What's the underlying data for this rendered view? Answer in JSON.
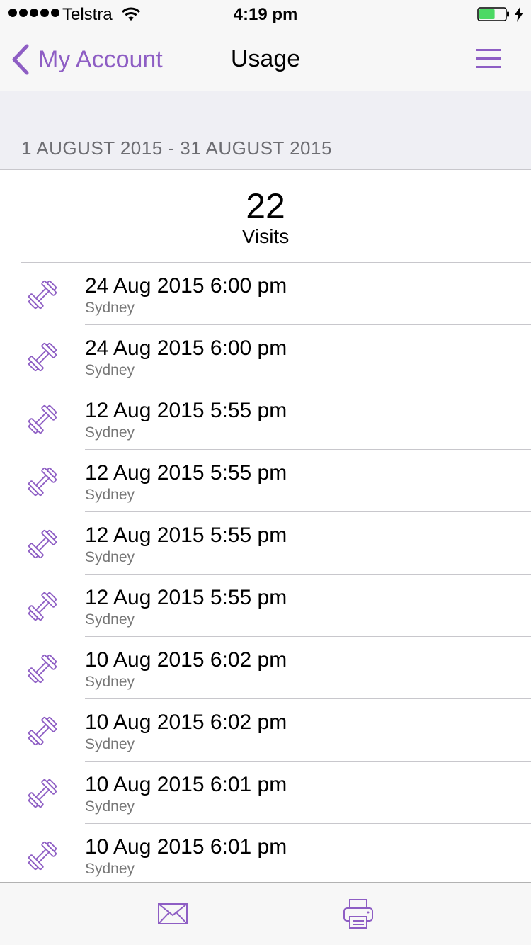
{
  "status_bar": {
    "carrier": "Telstra",
    "time": "4:19 pm",
    "signal_icon": "signal-dots-icon",
    "wifi_icon": "wifi-icon",
    "battery_icon": "battery-icon",
    "battery_level": 0.6,
    "charging_icon": "charging-bolt-icon"
  },
  "nav": {
    "back_label": "My Account",
    "title": "Usage",
    "back_icon": "chevron-left-icon",
    "menu_icon": "hamburger-menu-icon"
  },
  "period": {
    "label": "1 AUGUST 2015 - 31 AUGUST 2015"
  },
  "summary": {
    "count": "22",
    "label": "Visits"
  },
  "visits": [
    {
      "datetime": "24 Aug 2015 6:00 pm",
      "location": "Sydney"
    },
    {
      "datetime": "24 Aug 2015 6:00 pm",
      "location": "Sydney"
    },
    {
      "datetime": "12 Aug 2015 5:55 pm",
      "location": "Sydney"
    },
    {
      "datetime": "12 Aug 2015 5:55 pm",
      "location": "Sydney"
    },
    {
      "datetime": "12 Aug 2015 5:55 pm",
      "location": "Sydney"
    },
    {
      "datetime": "12 Aug 2015 5:55 pm",
      "location": "Sydney"
    },
    {
      "datetime": "10 Aug 2015 6:02 pm",
      "location": "Sydney"
    },
    {
      "datetime": "10 Aug 2015 6:02 pm",
      "location": "Sydney"
    },
    {
      "datetime": "10 Aug 2015 6:01 pm",
      "location": "Sydney"
    },
    {
      "datetime": "10 Aug 2015 6:01 pm",
      "location": "Sydney"
    }
  ],
  "visit_icon": "dumbbell-icon",
  "toolbar": {
    "email_icon": "envelope-icon",
    "print_icon": "printer-icon"
  },
  "colors": {
    "accent": "#8e5ec4",
    "battery_fill": "#4cd964",
    "header_bg": "#efeff4",
    "bar_bg": "#f7f7f7"
  }
}
